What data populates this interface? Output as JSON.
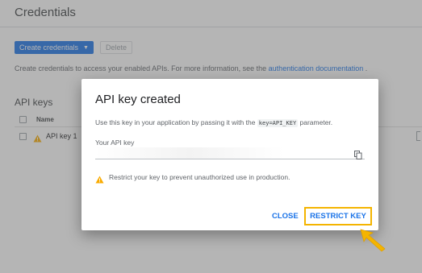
{
  "page": {
    "title": "Credentials",
    "create_button_label": "Create credentials",
    "delete_button_label": "Delete",
    "info_text": "Create credentials to access your enabled APIs. For more information, see the ",
    "info_link": "authentication documentation",
    "info_suffix": " .",
    "section_title": "API keys",
    "table_header_name": "Name",
    "rows": [
      {
        "name": "API key 1"
      }
    ]
  },
  "dialog": {
    "title": "API key created",
    "description_before": "Use this key in your application by passing it with the ",
    "description_code": "key=API_KEY",
    "description_after": " parameter.",
    "key_label": "Your API key",
    "key_value": "",
    "warning_text": "Restrict your key to prevent unauthorized use in production.",
    "close_label": "CLOSE",
    "restrict_label": "RESTRICT KEY"
  },
  "colors": {
    "accent": "#1a73e8",
    "highlight": "#f4b400",
    "warning": "#f9ab00"
  },
  "icons": {
    "dropdown": "chevron-down-icon",
    "copy": "copy-icon",
    "warning": "warning-icon",
    "pointer": "arrow-pointer-icon"
  }
}
